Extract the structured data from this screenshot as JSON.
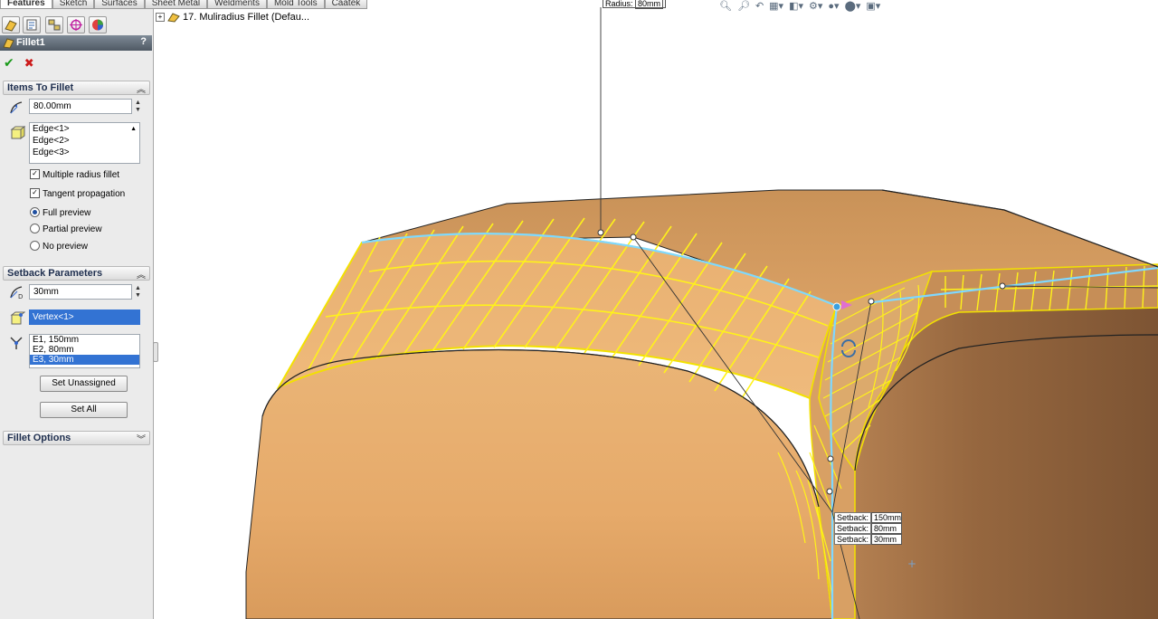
{
  "command_tabs": [
    "Features",
    "Sketch",
    "Surfaces",
    "Sheet Metal",
    "Weldments",
    "Mold Tools",
    "Caatek"
  ],
  "feature_tree": {
    "item": "17. Muliradius Fillet  (Defau..."
  },
  "property_manager": {
    "title": "Fillet1",
    "help": "?",
    "ok": "✔",
    "cancel": "✖",
    "items_section": {
      "label": "Items To Fillet",
      "radius": "80.00mm",
      "edges": [
        "Edge<1>",
        "Edge<2>",
        "Edge<3>"
      ],
      "multiple_radius": "Multiple radius fillet",
      "tangent": "Tangent propagation",
      "full_preview": "Full preview",
      "partial_preview": "Partial preview",
      "no_preview": "No preview"
    },
    "setback_section": {
      "label": "Setback Parameters",
      "distance": "30mm",
      "vertex": "Vertex<1>",
      "setbacks": [
        "E1, 150mm",
        "E2, 80mm",
        "E3, 30mm"
      ],
      "set_unassigned": "Set Unassigned",
      "set_all": "Set All"
    },
    "options_section": {
      "label": "Fillet Options"
    }
  },
  "callouts": {
    "radius_label": "Radius:",
    "radius_value": "80mm",
    "setbacks": [
      {
        "label": "Setback:",
        "value": "150mm"
      },
      {
        "label": "Setback:",
        "value": "80mm"
      },
      {
        "label": "Setback:",
        "value": "30mm"
      }
    ]
  },
  "view_toolbar_icons": [
    "zoom-fit-icon",
    "zoom-area-icon",
    "previous-view-icon",
    "section-view-icon",
    "view-orientation-icon",
    "display-style-icon",
    "hide-show-icon",
    "appearance-icon",
    "scene-icon",
    "display-pane-icon"
  ],
  "colors": {
    "part": "#e3a968",
    "fillet_grid": "#fff21a",
    "edge_highlight": "#7fd8ff",
    "pm_bg": "#ebebeb"
  }
}
